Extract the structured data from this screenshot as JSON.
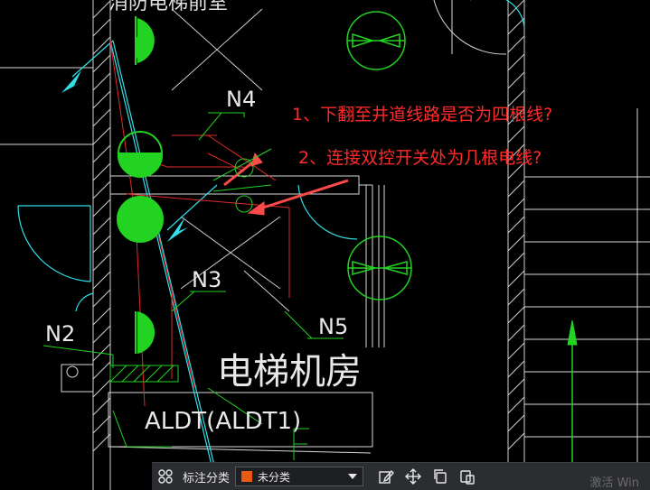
{
  "drawing": {
    "labels": {
      "n4": "N4",
      "n3": "N3",
      "n2": "N2",
      "n5": "N5",
      "room": "电梯机房",
      "panel": "ALDT(ALDT1)",
      "top_partial": "消防电梯前室"
    }
  },
  "questions": {
    "q1": "1、下翻至井道线路是否为四根线?",
    "q2": "2、连接双控开关处为几根电线?"
  },
  "toolbar": {
    "label": "标注分类",
    "selected_category": "未分类",
    "swatch_color": "#e85a14",
    "icons": [
      "grid-icon",
      "edit-icon",
      "move-icon",
      "copy-icon",
      "paste-icon"
    ]
  },
  "watermark": "激活 Win"
}
